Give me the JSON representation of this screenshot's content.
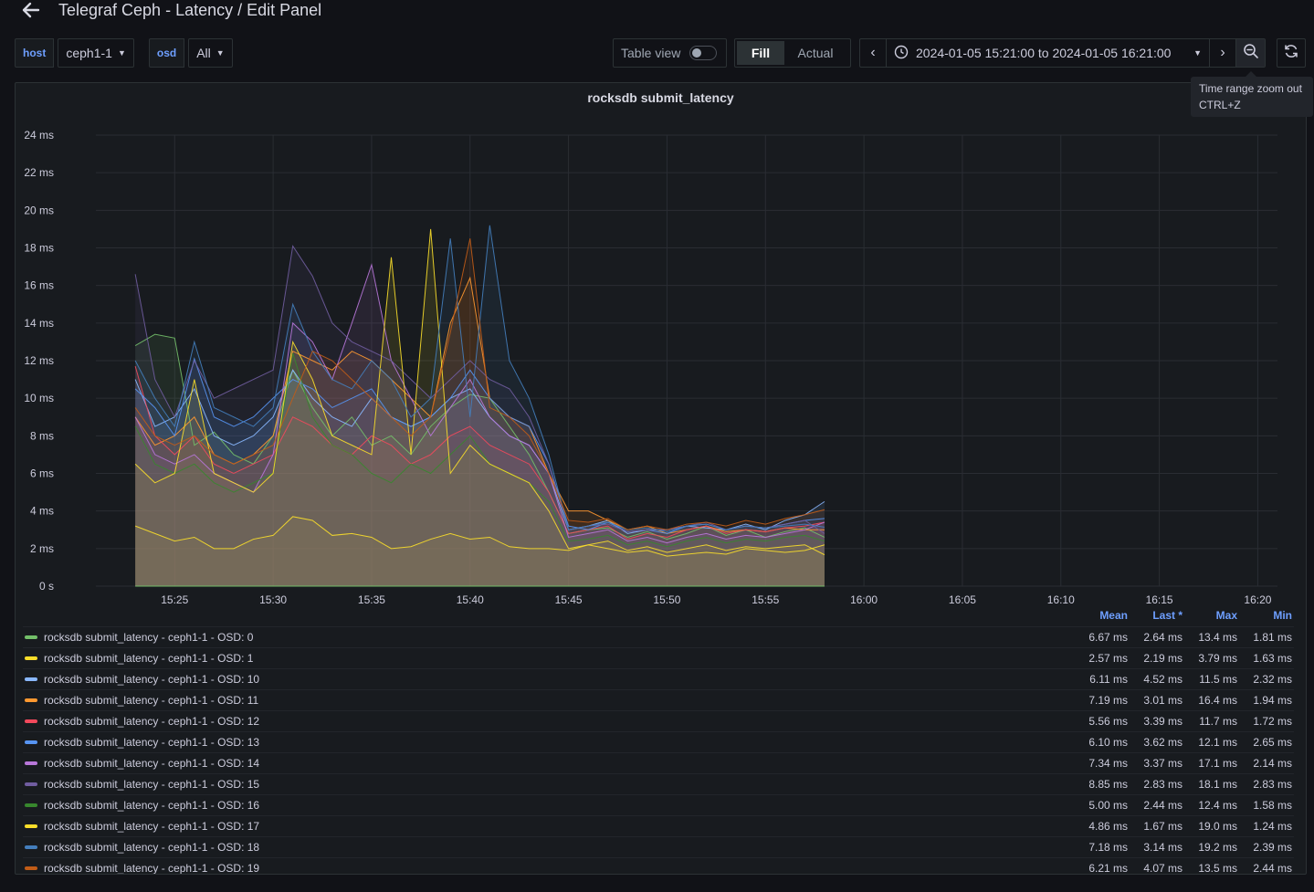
{
  "header": {
    "title": "Telegraf Ceph - Latency / Edit Panel"
  },
  "variables": [
    {
      "label": "host",
      "value": "ceph1-1"
    },
    {
      "label": "osd",
      "value": "All"
    }
  ],
  "toolbar": {
    "table_view_label": "Table view",
    "fill_label": "Fill",
    "actual_label": "Actual",
    "time_range": "2024-01-05 15:21:00 to 2024-01-05 16:21:00"
  },
  "tooltip": {
    "line1": "Time range zoom out",
    "line2": "CTRL+Z"
  },
  "panel": {
    "title": "rocksdb submit_latency"
  },
  "legend": {
    "columns": [
      "Mean",
      "Last *",
      "Max",
      "Min"
    ],
    "rows": [
      {
        "name": "rocksdb submit_latency - ceph1-1 - OSD: 0",
        "color": "#73bf69",
        "mean": "6.67 ms",
        "last": "2.64 ms",
        "max": "13.4 ms",
        "min": "1.81 ms"
      },
      {
        "name": "rocksdb submit_latency - ceph1-1 - OSD: 1",
        "color": "#fade2a",
        "mean": "2.57 ms",
        "last": "2.19 ms",
        "max": "3.79 ms",
        "min": "1.63 ms"
      },
      {
        "name": "rocksdb submit_latency - ceph1-1 - OSD: 10",
        "color": "#8ab8ff",
        "mean": "6.11 ms",
        "last": "4.52 ms",
        "max": "11.5 ms",
        "min": "2.32 ms"
      },
      {
        "name": "rocksdb submit_latency - ceph1-1 - OSD: 11",
        "color": "#ff9830",
        "mean": "7.19 ms",
        "last": "3.01 ms",
        "max": "16.4 ms",
        "min": "1.94 ms"
      },
      {
        "name": "rocksdb submit_latency - ceph1-1 - OSD: 12",
        "color": "#f2495c",
        "mean": "5.56 ms",
        "last": "3.39 ms",
        "max": "11.7 ms",
        "min": "1.72 ms"
      },
      {
        "name": "rocksdb submit_latency - ceph1-1 - OSD: 13",
        "color": "#5794f2",
        "mean": "6.10 ms",
        "last": "3.62 ms",
        "max": "12.1 ms",
        "min": "2.65 ms"
      },
      {
        "name": "rocksdb submit_latency - ceph1-1 - OSD: 14",
        "color": "#b877d9",
        "mean": "7.34 ms",
        "last": "3.37 ms",
        "max": "17.1 ms",
        "min": "2.14 ms"
      },
      {
        "name": "rocksdb submit_latency - ceph1-1 - OSD: 15",
        "color": "#705da0",
        "mean": "8.85 ms",
        "last": "2.83 ms",
        "max": "18.1 ms",
        "min": "2.83 ms"
      },
      {
        "name": "rocksdb submit_latency - ceph1-1 - OSD: 16",
        "color": "#37872d",
        "mean": "5.00 ms",
        "last": "2.44 ms",
        "max": "12.4 ms",
        "min": "1.58 ms"
      },
      {
        "name": "rocksdb submit_latency - ceph1-1 - OSD: 17",
        "color": "#fade2a",
        "mean": "4.86 ms",
        "last": "1.67 ms",
        "max": "19.0 ms",
        "min": "1.24 ms"
      },
      {
        "name": "rocksdb submit_latency - ceph1-1 - OSD: 18",
        "color": "#447ebc",
        "mean": "7.18 ms",
        "last": "3.14 ms",
        "max": "19.2 ms",
        "min": "2.39 ms"
      },
      {
        "name": "rocksdb submit_latency - ceph1-1 - OSD: 19",
        "color": "#c15c17",
        "mean": "6.21 ms",
        "last": "4.07 ms",
        "max": "13.5 ms",
        "min": "2.44 ms"
      }
    ]
  },
  "chart_data": {
    "type": "area",
    "title": "rocksdb submit_latency",
    "xlim": [
      "15:21",
      "16:21"
    ],
    "x_ticks": [
      "15:25",
      "15:30",
      "15:35",
      "15:40",
      "15:45",
      "15:50",
      "15:55",
      "16:00",
      "16:05",
      "16:10",
      "16:15",
      "16:20"
    ],
    "ylim": [
      0,
      24
    ],
    "y_ticks": [
      "0 s",
      "2 ms",
      "4 ms",
      "6 ms",
      "8 ms",
      "10 ms",
      "12 ms",
      "14 ms",
      "16 ms",
      "18 ms",
      "20 ms",
      "22 ms",
      "24 ms"
    ],
    "grid": true,
    "legend_placement": "bottom",
    "x": [
      "15:23",
      "15:24",
      "15:25",
      "15:26",
      "15:27",
      "15:28",
      "15:29",
      "15:30",
      "15:31",
      "15:32",
      "15:33",
      "15:34",
      "15:35",
      "15:36",
      "15:37",
      "15:38",
      "15:39",
      "15:40",
      "15:41",
      "15:42",
      "15:43",
      "15:44",
      "15:45",
      "15:46",
      "15:47",
      "15:48",
      "15:49",
      "15:50",
      "15:51",
      "15:52",
      "15:53",
      "15:54",
      "15:55",
      "15:56",
      "15:57",
      "15:58"
    ],
    "series": [
      {
        "name": "rocksdb submit_latency - ceph1-1 - OSD: 0",
        "color": "#73bf69",
        "values": [
          12.8,
          13.4,
          13.2,
          7.5,
          8.2,
          7.0,
          6.5,
          8.0,
          11.5,
          9.5,
          8.0,
          9.0,
          7.5,
          8.0,
          7.0,
          8.5,
          9.5,
          10.2,
          10.0,
          8.5,
          7.0,
          5.0,
          2.8,
          3.0,
          3.1,
          2.6,
          2.9,
          2.5,
          2.8,
          3.2,
          2.7,
          3.0,
          2.6,
          2.9,
          3.1,
          2.6
        ]
      },
      {
        "name": "rocksdb submit_latency - ceph1-1 - OSD: 1",
        "color": "#fade2a",
        "values": [
          3.2,
          2.8,
          2.4,
          2.6,
          2.0,
          2.0,
          2.5,
          2.7,
          3.7,
          3.5,
          2.7,
          2.8,
          2.6,
          2.0,
          2.1,
          2.5,
          2.8,
          2.5,
          2.6,
          2.1,
          2.0,
          2.0,
          1.9,
          2.2,
          2.0,
          1.8,
          1.9,
          1.6,
          1.7,
          1.8,
          1.7,
          2.0,
          1.9,
          1.8,
          1.9,
          2.2
        ]
      },
      {
        "name": "rocksdb submit_latency - ceph1-1 - OSD: 10",
        "color": "#8ab8ff",
        "values": [
          11.0,
          8.5,
          9.0,
          10.5,
          8.0,
          7.5,
          8.0,
          9.0,
          11.5,
          10.0,
          9.0,
          8.5,
          10.0,
          9.0,
          8.5,
          9.0,
          10.0,
          10.5,
          9.0,
          8.0,
          7.5,
          6.0,
          3.0,
          3.2,
          3.5,
          2.8,
          3.0,
          3.0,
          3.2,
          3.1,
          3.0,
          3.3,
          3.0,
          3.5,
          3.8,
          4.5
        ]
      },
      {
        "name": "rocksdb submit_latency - ceph1-1 - OSD: 11",
        "color": "#ff9830",
        "values": [
          9.0,
          7.5,
          8.0,
          9.0,
          7.0,
          6.5,
          7.0,
          8.0,
          12.5,
          12.0,
          11.5,
          12.5,
          12.0,
          11.0,
          10.0,
          9.0,
          14.0,
          16.4,
          10.0,
          9.0,
          8.5,
          6.0,
          4.0,
          4.0,
          3.5,
          3.0,
          3.2,
          2.8,
          3.0,
          3.2,
          2.9,
          3.0,
          2.9,
          3.1,
          3.0,
          3.0
        ]
      },
      {
        "name": "rocksdb submit_latency - ceph1-1 - OSD: 12",
        "color": "#f2495c",
        "values": [
          11.7,
          8.0,
          7.0,
          8.0,
          6.5,
          6.0,
          6.5,
          7.0,
          9.0,
          8.5,
          7.5,
          7.0,
          8.0,
          7.5,
          6.5,
          7.0,
          8.0,
          8.5,
          7.5,
          7.0,
          6.5,
          5.0,
          2.8,
          3.0,
          3.2,
          2.5,
          2.8,
          2.6,
          3.0,
          3.2,
          2.8,
          3.0,
          2.9,
          3.1,
          3.2,
          3.4
        ]
      },
      {
        "name": "rocksdb submit_latency - ceph1-1 - OSD: 13",
        "color": "#5794f2",
        "values": [
          10.5,
          9.5,
          8.0,
          12.1,
          9.0,
          8.5,
          9.0,
          10.0,
          11.0,
          10.5,
          9.5,
          10.0,
          10.5,
          9.0,
          8.5,
          9.0,
          10.0,
          11.5,
          10.0,
          9.0,
          8.5,
          6.5,
          3.2,
          3.0,
          3.4,
          2.9,
          3.0,
          2.8,
          3.2,
          3.3,
          3.0,
          3.2,
          3.1,
          3.3,
          3.5,
          3.6
        ]
      },
      {
        "name": "rocksdb submit_latency - ceph1-1 - OSD: 14",
        "color": "#b877d9",
        "values": [
          9.0,
          7.0,
          6.5,
          7.0,
          6.0,
          5.5,
          5.0,
          7.0,
          14.0,
          13.0,
          11.0,
          14.0,
          17.1,
          12.0,
          10.0,
          8.0,
          9.5,
          11.0,
          9.0,
          8.0,
          7.5,
          6.0,
          2.6,
          2.8,
          3.0,
          2.4,
          2.6,
          2.3,
          2.6,
          2.8,
          2.5,
          2.7,
          2.6,
          2.8,
          3.0,
          3.4
        ]
      },
      {
        "name": "rocksdb submit_latency - ceph1-1 - OSD: 15",
        "color": "#705da0",
        "values": [
          16.6,
          11.0,
          9.0,
          12.0,
          10.0,
          10.5,
          11.0,
          11.5,
          18.1,
          16.5,
          14.0,
          13.0,
          12.5,
          12.0,
          11.0,
          10.0,
          11.0,
          12.0,
          11.0,
          10.5,
          9.0,
          6.5,
          3.0,
          3.2,
          3.3,
          2.9,
          3.0,
          3.0,
          3.2,
          3.4,
          3.0,
          3.2,
          3.1,
          3.3,
          3.5,
          2.8
        ]
      },
      {
        "name": "rocksdb submit_latency - ceph1-1 - OSD: 16",
        "color": "#37872d",
        "values": [
          8.5,
          6.5,
          6.0,
          6.5,
          5.5,
          5.0,
          5.5,
          6.0,
          12.4,
          9.0,
          7.5,
          7.0,
          6.0,
          5.5,
          6.5,
          6.0,
          7.0,
          8.0,
          6.5,
          6.0,
          5.5,
          4.5,
          2.4,
          2.5,
          2.7,
          2.2,
          2.4,
          2.1,
          2.4,
          2.6,
          2.3,
          2.5,
          2.4,
          2.6,
          2.7,
          2.4
        ]
      },
      {
        "name": "rocksdb submit_latency - ceph1-1 - OSD: 17",
        "color": "#fade2a",
        "values": [
          6.5,
          5.5,
          6.0,
          11.0,
          6.0,
          5.5,
          5.0,
          6.0,
          13.0,
          11.0,
          8.0,
          7.5,
          7.0,
          17.5,
          7.0,
          19.0,
          6.0,
          7.5,
          6.5,
          6.0,
          5.5,
          4.0,
          2.0,
          2.2,
          2.4,
          1.9,
          2.1,
          1.8,
          2.0,
          2.2,
          1.9,
          2.1,
          2.0,
          2.1,
          2.2,
          1.67
        ]
      },
      {
        "name": "rocksdb submit_latency - ceph1-1 - OSD: 18",
        "color": "#447ebc",
        "values": [
          12.0,
          10.0,
          8.5,
          13.0,
          9.5,
          9.0,
          8.5,
          9.5,
          15.0,
          12.5,
          11.0,
          10.5,
          12.0,
          11.0,
          9.0,
          10.0,
          18.5,
          9.0,
          19.2,
          12.0,
          10.0,
          7.0,
          3.0,
          3.2,
          3.4,
          3.0,
          3.1,
          2.9,
          3.2,
          3.3,
          3.0,
          3.2,
          3.1,
          3.2,
          3.3,
          3.14
        ]
      },
      {
        "name": "rocksdb submit_latency - ceph1-1 - OSD: 19",
        "color": "#c15c17",
        "values": [
          9.5,
          8.0,
          7.5,
          8.0,
          7.0,
          6.5,
          7.0,
          7.5,
          10.0,
          12.5,
          12.0,
          11.0,
          10.0,
          9.0,
          8.0,
          9.0,
          13.5,
          18.5,
          9.5,
          9.0,
          8.0,
          6.0,
          3.5,
          3.4,
          3.6,
          3.0,
          3.2,
          3.0,
          3.3,
          3.4,
          3.2,
          3.5,
          3.3,
          3.6,
          3.8,
          4.07
        ]
      }
    ]
  }
}
